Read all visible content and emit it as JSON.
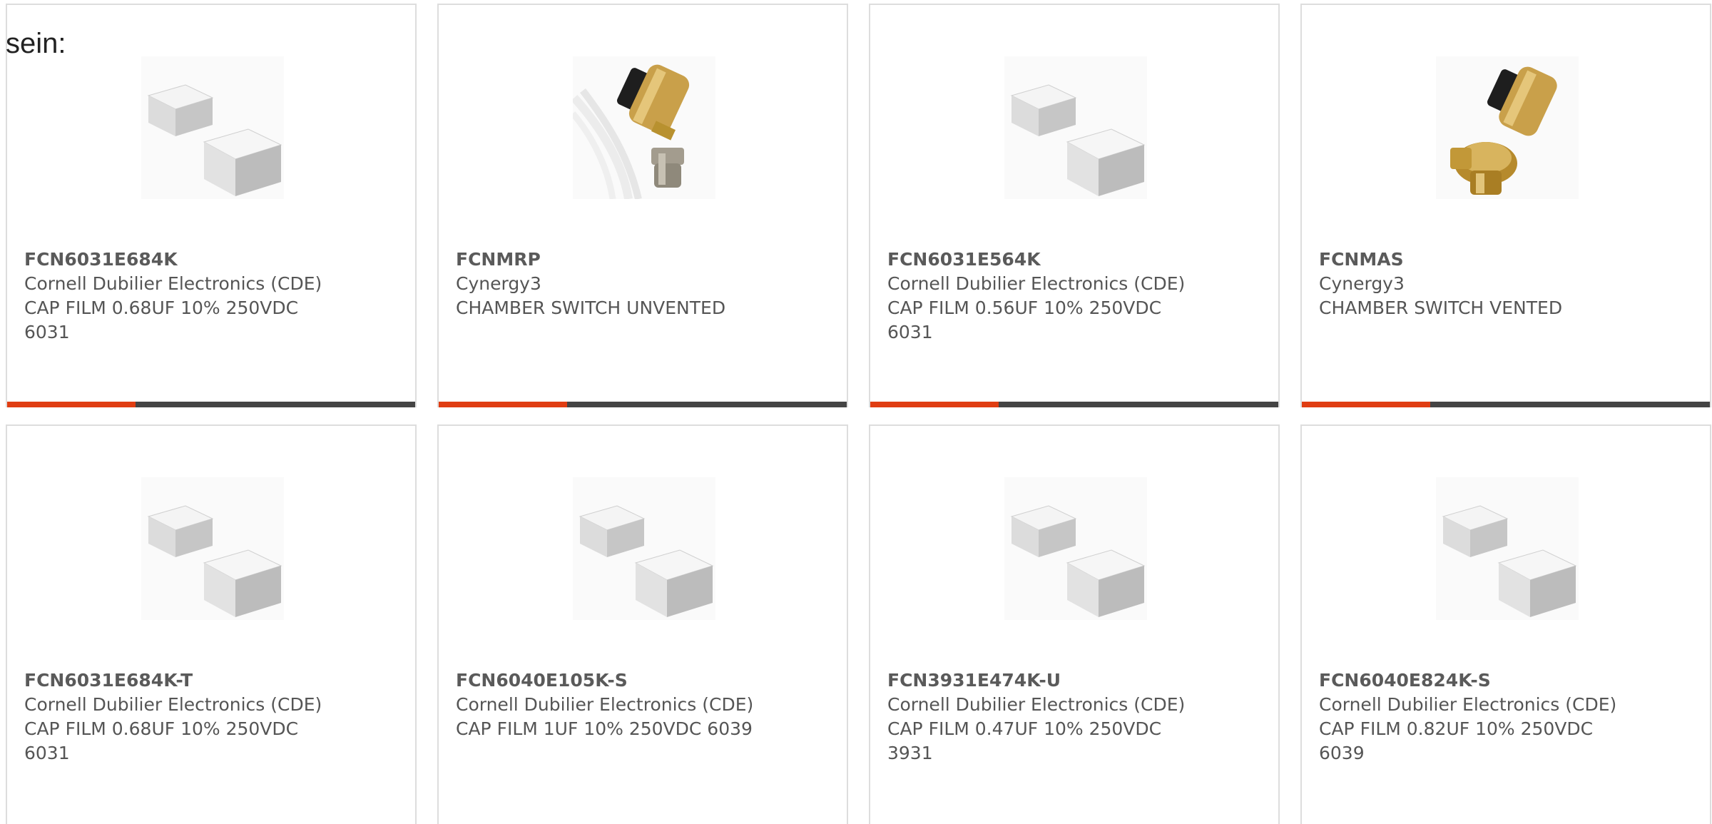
{
  "intro_text": "sein:",
  "colors": {
    "accent": "#e03d12",
    "bar": "#444444",
    "border": "#dddddd",
    "text": "#555555"
  },
  "products": [
    {
      "part_number": "FCN6031E684K",
      "manufacturer": "Cornell Dubilier Electronics (CDE)",
      "description": "CAP FILM 0.68UF 10% 250VDC 6031",
      "image_icon": "film-capacitor-image"
    },
    {
      "part_number": "FCNMRP",
      "manufacturer": "Cynergy3",
      "description": "CHAMBER SWITCH UNVENTED",
      "image_icon": "chamber-switch-unvented-image"
    },
    {
      "part_number": "FCN6031E564K",
      "manufacturer": "Cornell Dubilier Electronics (CDE)",
      "description": "CAP FILM 0.56UF 10% 250VDC 6031",
      "image_icon": "film-capacitor-image"
    },
    {
      "part_number": "FCNMAS",
      "manufacturer": "Cynergy3",
      "description": "CHAMBER SWITCH VENTED",
      "image_icon": "chamber-switch-vented-image"
    },
    {
      "part_number": "FCN6031E684K-T",
      "manufacturer": "Cornell Dubilier Electronics (CDE)",
      "description": "CAP FILM 0.68UF 10% 250VDC 6031",
      "image_icon": "film-capacitor-image"
    },
    {
      "part_number": "FCN6040E105K-S",
      "manufacturer": "Cornell Dubilier Electronics (CDE)",
      "description": "CAP FILM 1UF 10% 250VDC 6039",
      "image_icon": "film-capacitor-image"
    },
    {
      "part_number": "FCN3931E474K-U",
      "manufacturer": "Cornell Dubilier Electronics (CDE)",
      "description": "CAP FILM 0.47UF 10% 250VDC 3931",
      "image_icon": "film-capacitor-image"
    },
    {
      "part_number": "FCN6040E824K-S",
      "manufacturer": "Cornell Dubilier Electronics (CDE)",
      "description": "CAP FILM 0.82UF 10% 250VDC 6039",
      "image_icon": "film-capacitor-image"
    }
  ]
}
